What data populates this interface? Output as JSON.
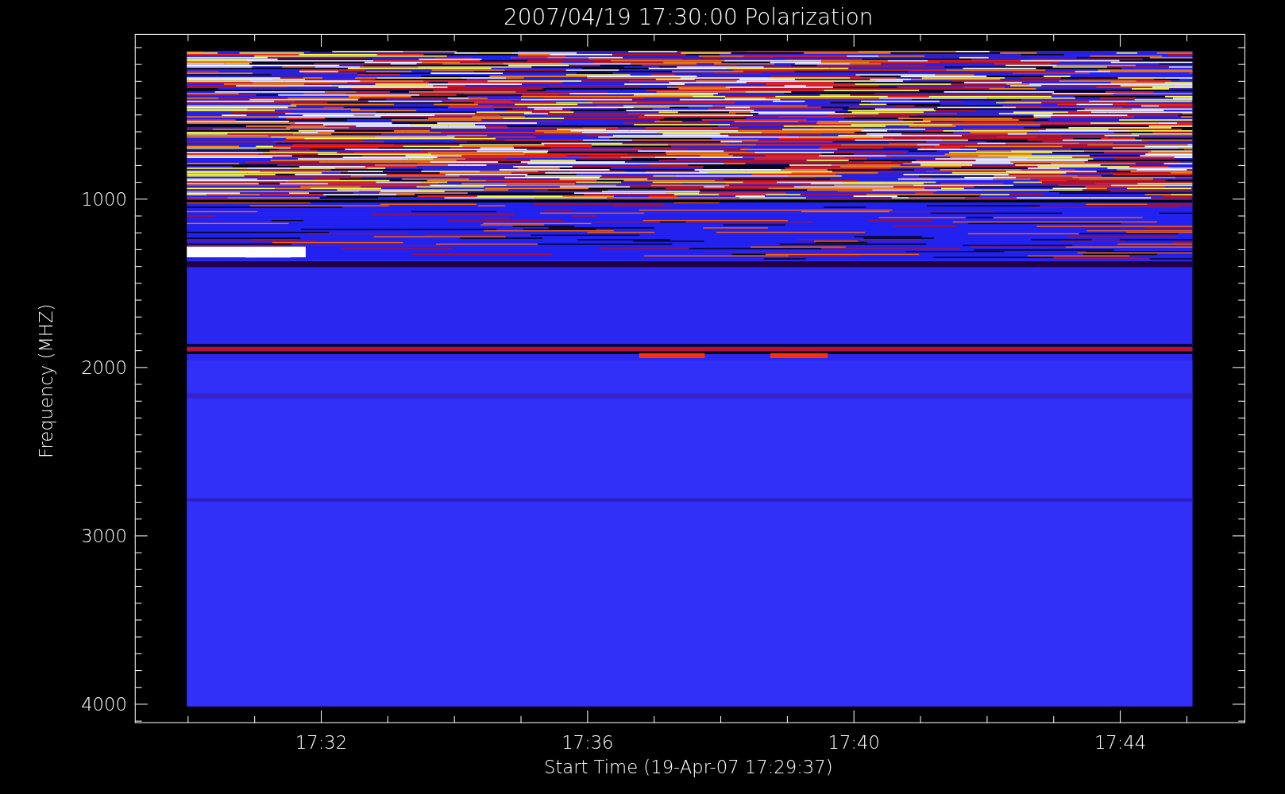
{
  "title": "2007/04/19 17:30:00 Polarization",
  "y_axis": {
    "label": "Frequency (MHZ)",
    "ticks": [
      "1000",
      "2000",
      "3000",
      "4000"
    ]
  },
  "x_axis": {
    "label": "Start Time (19-Apr-07 17:29:37)",
    "ticks": [
      "17:32",
      "17:36",
      "17:40",
      "17:44"
    ]
  }
}
